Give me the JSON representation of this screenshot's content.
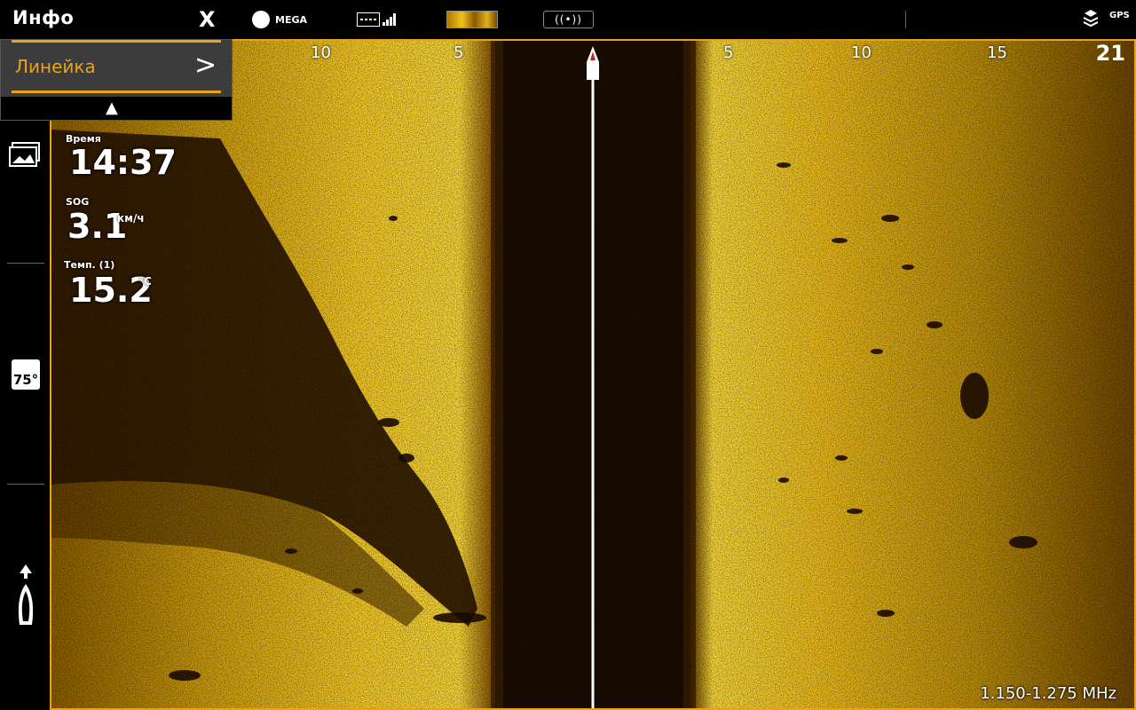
{
  "header": {
    "title": "Инфо",
    "close_label": "X",
    "mega_label": "MEGA",
    "transducer_label": "((•))",
    "gps_label": "GPS"
  },
  "info_menu": {
    "item_label": "Линейка",
    "chevron": ">",
    "collapse_glyph": "▲"
  },
  "sidebar": {
    "temp_icon_label": "75°"
  },
  "data_overlay": {
    "time_label": "Время",
    "time_value": "14:37",
    "sog_label": "SOG",
    "sog_value": "3.1",
    "sog_unit": "км/ч",
    "temp_label": "Темп. (1)",
    "temp_value": "15.2",
    "temp_unit": "°C"
  },
  "sonar": {
    "scale_labels": [
      "10",
      "5",
      "5",
      "10",
      "15"
    ],
    "range": "21",
    "frequency": "1.150-1.275 MHz"
  },
  "colors": {
    "accent": "#e8a317",
    "sonar_bright": "#f2c21a",
    "sonar_dark": "#6b3f00"
  }
}
